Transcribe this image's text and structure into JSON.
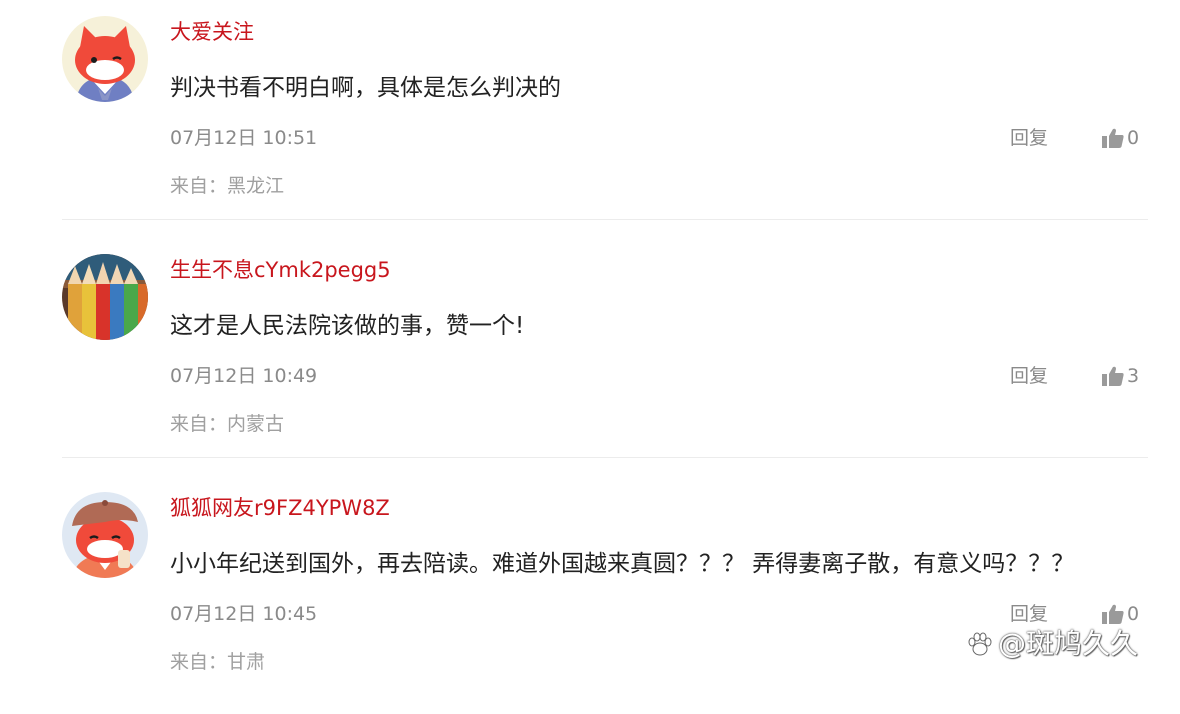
{
  "comments": [
    {
      "avatar": "fox-mascot-sailor-icon",
      "username": "大爱关注",
      "content": "判决书看不明白啊，具体是怎么判决的",
      "time": "07月12日 10:51",
      "reply_label": "回复",
      "likes": "0",
      "location": "来自：黑龙江"
    },
    {
      "avatar": "colored-pencils-photo",
      "username": "生生不息cYmk2pegg5",
      "content": "这才是人民法院该做的事，赞一个!",
      "time": "07月12日 10:49",
      "reply_label": "回复",
      "likes": "3",
      "location": "来自：内蒙古"
    },
    {
      "avatar": "fox-mascot-beret-icon",
      "username": "狐狐网友r9FZ4YPW8Z",
      "content": "小小年纪送到国外，再去陪读。难道外国越来真圆？？？ 弄得妻离子散，有意义吗？？？",
      "time": "07月12日 10:45",
      "reply_label": "回复",
      "likes": "0",
      "location": "来自：甘肃"
    }
  ],
  "watermark": "@斑鸠久久",
  "colors": {
    "username": "#c8161d",
    "content": "#222222",
    "meta": "#8a8a8a",
    "divider": "#ececec"
  }
}
